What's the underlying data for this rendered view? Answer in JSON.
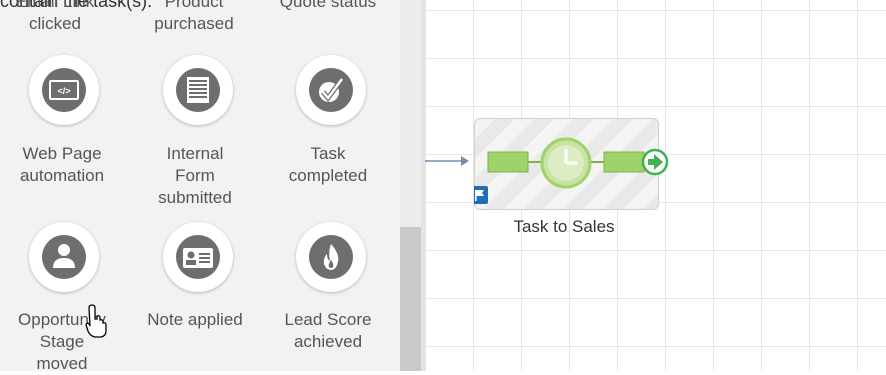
{
  "palette": {
    "cut_top_text": "contain the task(s).",
    "row0": [
      "Email Link clicked",
      "Product purchased",
      "Quote status"
    ],
    "items": [
      {
        "label_lines": [
          "Web Page",
          "automation"
        ],
        "icon": "code-icon"
      },
      {
        "label_lines": [
          "Internal",
          "Form",
          "submitted"
        ],
        "icon": "form-icon"
      },
      {
        "label_lines": [
          "Task",
          "completed"
        ],
        "icon": "checkmark-icon"
      },
      {
        "label_lines": [
          "Opportunity",
          "Stage",
          "moved"
        ],
        "icon": "person-icon"
      },
      {
        "label_lines": [
          "Note applied"
        ],
        "icon": "id-card-icon"
      },
      {
        "label_lines": [
          "Lead Score",
          "achieved"
        ],
        "icon": "flame-icon"
      }
    ]
  },
  "canvas": {
    "node": {
      "label": "Task to Sales",
      "icon": "clock-icon",
      "badge_icon": "flag-icon"
    }
  },
  "colors": {
    "node_green": "#9fd36a",
    "badge_blue": "#1e6fb5",
    "icon_gray": "#6e6e6e"
  }
}
